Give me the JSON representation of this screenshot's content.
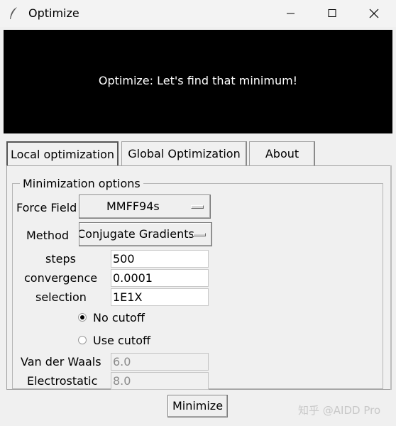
{
  "window": {
    "title": "Optimize",
    "icon": "feather-icon",
    "controls": [
      "minimize-icon",
      "maximize-icon",
      "close-icon"
    ]
  },
  "banner": {
    "text": "Optimize: Let's find that minimum!"
  },
  "tabs": [
    {
      "label": "Local optimization",
      "selected": true
    },
    {
      "label": "Global Optimization",
      "selected": false
    },
    {
      "label": "About",
      "selected": false
    }
  ],
  "group": {
    "title": "Minimization options"
  },
  "form": {
    "force_field": {
      "label": "Force Field",
      "value": "MMFF94s"
    },
    "method": {
      "label": "Method",
      "value": "Conjugate Gradients"
    },
    "steps": {
      "label": "steps",
      "value": "500"
    },
    "convergence": {
      "label": "convergence",
      "value": "0.0001"
    },
    "selection": {
      "label": "selection",
      "value": "1E1X"
    },
    "cutoff_options": [
      {
        "label": "No cutoff",
        "selected": true
      },
      {
        "label": "Use cutoff",
        "selected": false
      }
    ],
    "vdw": {
      "label": "Van der Waals",
      "value": "6.0"
    },
    "electrostatic": {
      "label": "Electrostatic",
      "value": "8.0"
    }
  },
  "actions": {
    "minimize_label": "Minimize"
  },
  "watermark": {
    "text": "知乎 @AIDD Pro"
  }
}
